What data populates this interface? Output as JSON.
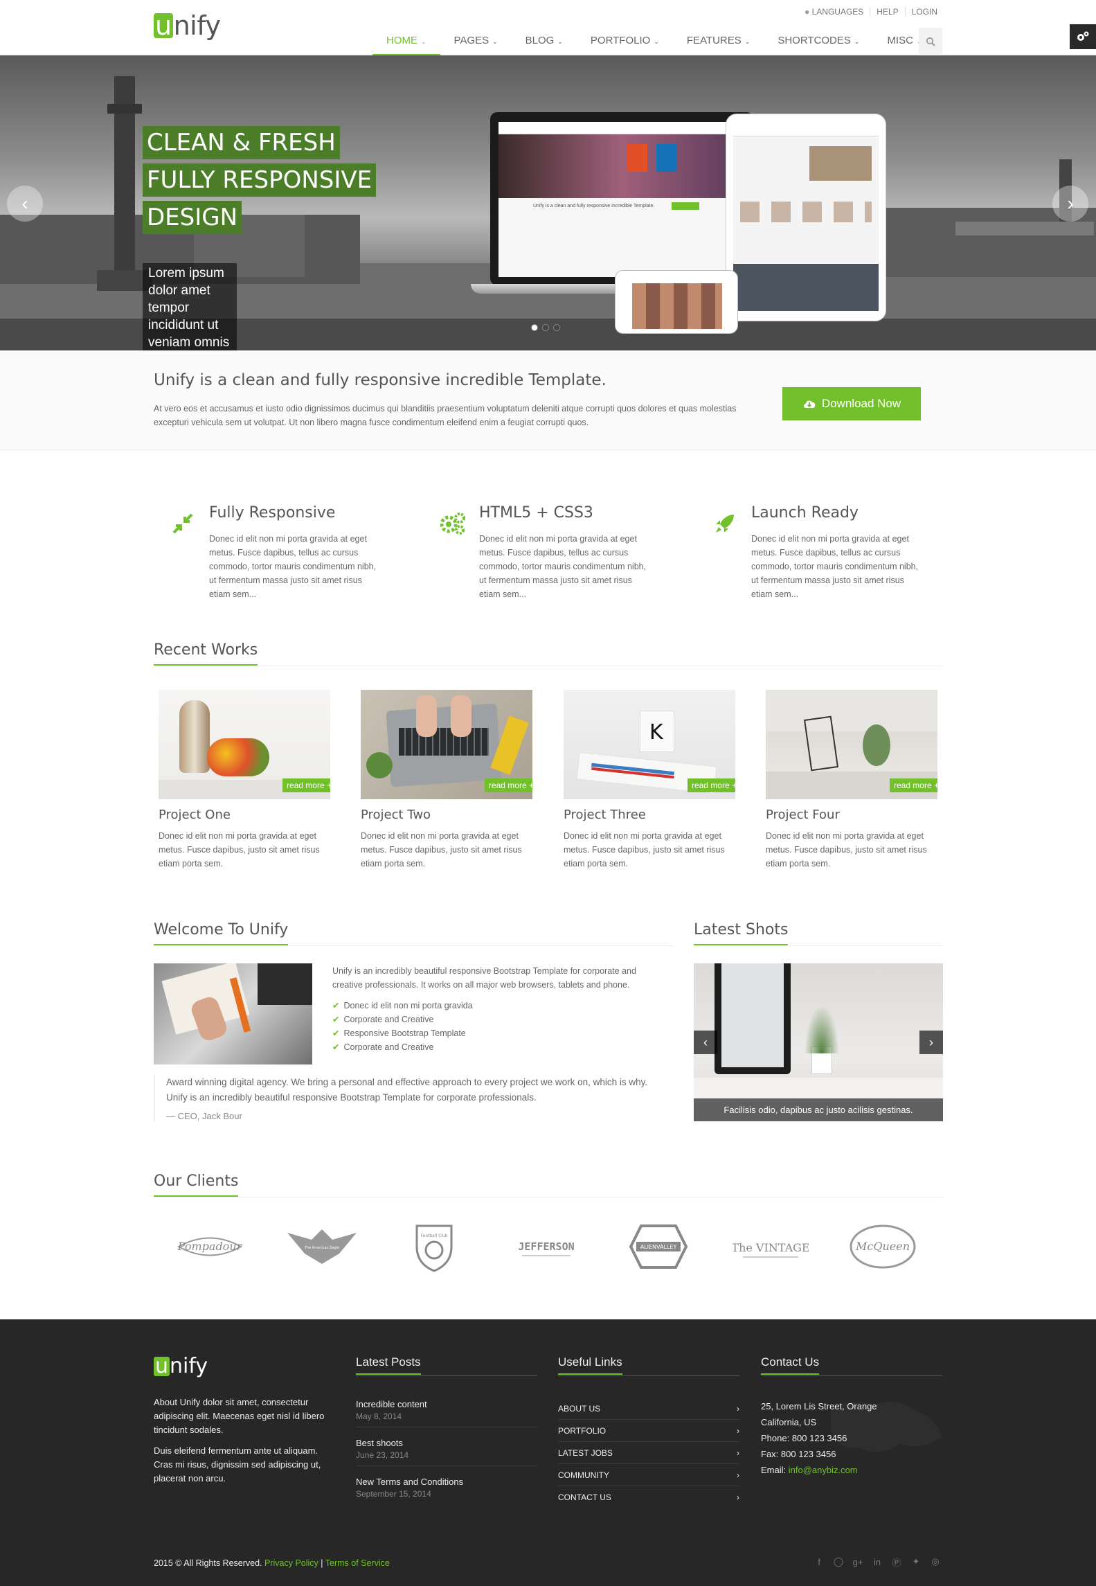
{
  "brand": {
    "logo_first": "u",
    "logo_rest": "nify",
    "accent": "#72c02c"
  },
  "topbar": {
    "languages": "LANGUAGES",
    "help": "HELP",
    "login": "LOGIN"
  },
  "nav": [
    {
      "label": "HOME",
      "active": true
    },
    {
      "label": "PAGES"
    },
    {
      "label": "BLOG"
    },
    {
      "label": "PORTFOLIO"
    },
    {
      "label": "FEATURES"
    },
    {
      "label": "SHORTCODES"
    },
    {
      "label": "MISC"
    }
  ],
  "hero": {
    "captions": [
      "CLEAN & FRESH",
      "FULLY RESPONSIVE",
      "DESIGN"
    ],
    "subcaption": "Lorem ipsum dolor amet tempor incididunt ut veniam omnis",
    "mock_tagline": "Unify is a clean and fully responsive incredible Template.",
    "slides": 3,
    "active_slide": 1
  },
  "purchase": {
    "title": "Unify is a clean and fully responsive incredible Template.",
    "text": "At vero eos et accusamus et iusto odio dignissimos ducimus qui blanditiis praesentium voluptatum deleniti atque corrupti quos dolores et quas molestias excepturi vehicula sem ut volutpat. Ut non libero magna fusce condimentum eleifend enim a feugiat corrupti quos.",
    "button": "Download Now"
  },
  "features": [
    {
      "icon": "compress-icon",
      "title": "Fully Responsive",
      "text": "Donec id elit non mi porta gravida at eget metus. Fusce dapibus, tellus ac cursus commodo, tortor mauris condimentum nibh, ut fermentum massa justo sit amet risus etiam sem..."
    },
    {
      "icon": "gears-icon",
      "title": "HTML5 + CSS3",
      "text": "Donec id elit non mi porta gravida at eget metus. Fusce dapibus, tellus ac cursus commodo, tortor mauris condimentum nibh, ut fermentum massa justo sit amet risus etiam sem..."
    },
    {
      "icon": "rocket-icon",
      "title": "Launch Ready",
      "text": "Donec id elit non mi porta gravida at eget metus. Fusce dapibus, tellus ac cursus commodo, tortor mauris condimentum nibh, ut fermentum massa justo sit amet risus etiam sem..."
    }
  ],
  "recent_works": {
    "heading": "Recent Works",
    "read_more": "read more +",
    "items": [
      {
        "title": "Project One",
        "text": "Donec id elit non mi porta gravida at eget metus. Fusce dapibus, justo sit amet risus etiam porta sem."
      },
      {
        "title": "Project Two",
        "text": "Donec id elit non mi porta gravida at eget metus. Fusce dapibus, justo sit amet risus etiam porta sem."
      },
      {
        "title": "Project Three",
        "text": "Donec id elit non mi porta gravida at eget metus. Fusce dapibus, justo sit amet risus etiam porta sem."
      },
      {
        "title": "Project Four",
        "text": "Donec id elit non mi porta gravida at eget metus. Fusce dapibus, justo sit amet risus etiam porta sem."
      }
    ]
  },
  "welcome": {
    "heading": "Welcome To Unify",
    "text": "Unify is an incredibly beautiful responsive Bootstrap Template for corporate and creative professionals. It works on all major web browsers, tablets and phone.",
    "checks": [
      "Donec id elit non mi porta gravida",
      "Corporate and Creative",
      "Responsive Bootstrap Template",
      "Corporate and Creative"
    ],
    "quote": "Award winning digital agency. We bring a personal and effective approach to every project we work on, which is why. Unify is an incredibly beautiful responsive Bootstrap Template for corporate professionals.",
    "quote_author": "— CEO, Jack Bour"
  },
  "latest_shots": {
    "heading": "Latest Shots",
    "caption": "Facilisis odio, dapibus ac justo acilisis gestinas."
  },
  "clients": {
    "heading": "Our Clients",
    "logos": [
      "Pompadour",
      "The American Eagle",
      "Football Club",
      "JEFFERSON",
      "ALIENVALLEY",
      "The VINTAGE",
      "McQueen"
    ]
  },
  "footer": {
    "about": [
      "About Unify dolor sit amet, consectetur adipiscing elit. Maecenas eget nisl id libero tincidunt sodales.",
      "Duis eleifend fermentum ante ut aliquam. Cras mi risus, dignissim sed adipiscing ut, placerat non arcu."
    ],
    "posts_heading": "Latest Posts",
    "posts": [
      {
        "title": "Incredible content",
        "date": "May 8, 2014"
      },
      {
        "title": "Best shoots",
        "date": "June 23, 2014"
      },
      {
        "title": "New Terms and Conditions",
        "date": "September 15, 2014"
      }
    ],
    "links_heading": "Useful Links",
    "links": [
      "ABOUT US",
      "PORTFOLIO",
      "LATEST JOBS",
      "COMMUNITY",
      "CONTACT US"
    ],
    "contact_heading": "Contact Us",
    "address1": "25, Lorem Lis Street, Orange",
    "address2": "California, US",
    "phone": "Phone: 800 123 3456",
    "fax": "Fax: 800 123 3456",
    "email_label": "Email: ",
    "email": "info@anybiz.com",
    "copyright": "2015 © All Rights Reserved.",
    "privacy": "Privacy Policy",
    "sep": "|",
    "terms": "Terms of Service",
    "social": [
      "facebook-icon",
      "skype-icon",
      "google-plus-icon",
      "linkedin-icon",
      "pinterest-icon",
      "twitter-icon",
      "dribbble-icon"
    ]
  }
}
